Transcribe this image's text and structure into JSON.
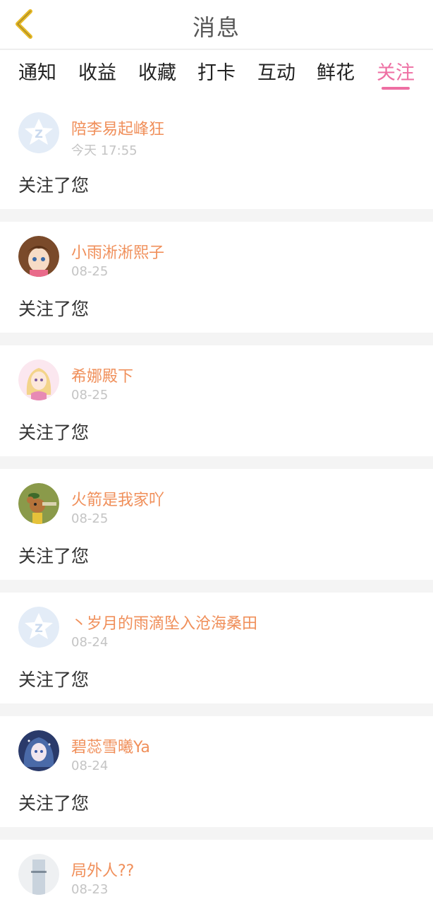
{
  "header": {
    "title": "消息",
    "back_icon": "chevron-left-icon",
    "accent_color": "#ee6fa3",
    "back_icon_color": "#e5b825"
  },
  "tabs": [
    {
      "label": "通知",
      "active": false
    },
    {
      "label": "收益",
      "active": false
    },
    {
      "label": "收藏",
      "active": false
    },
    {
      "label": "打卡",
      "active": false
    },
    {
      "label": "互动",
      "active": false
    },
    {
      "label": "鲜花",
      "active": false
    },
    {
      "label": "关注",
      "active": true
    }
  ],
  "messages": [
    {
      "username": "陪李易起峰狂",
      "time": "今天 17:55",
      "text": "关注了您",
      "avatar": "default-avatar-icon"
    },
    {
      "username": "小雨淅淅熙子",
      "time": "08-25",
      "text": "关注了您",
      "avatar": "anime-girl-avatar"
    },
    {
      "username": "希娜殿下",
      "time": "08-25",
      "text": "关注了您",
      "avatar": "anime-princess-avatar"
    },
    {
      "username": "火箭是我家吖",
      "time": "08-25",
      "text": "关注了您",
      "avatar": "cartoon-mouse-avatar"
    },
    {
      "username": "丶岁月的雨滴坠入沧海桑田",
      "time": "08-24",
      "text": "关注了您",
      "avatar": "default-avatar-icon"
    },
    {
      "username": "碧蕊雪曦Ya",
      "time": "08-24",
      "text": "关注了您",
      "avatar": "anime-snow-girl-avatar"
    },
    {
      "username": "局外人??",
      "time": "08-23",
      "text": "",
      "avatar": "photo-avatar"
    }
  ]
}
